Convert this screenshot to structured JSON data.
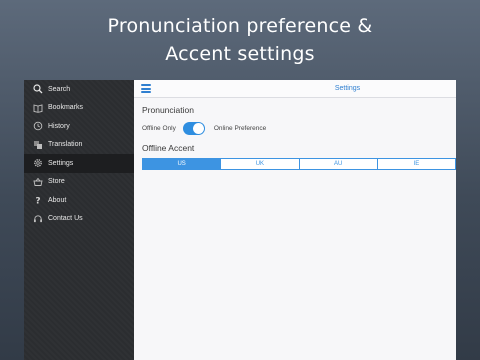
{
  "promo": {
    "line1": "Pronunciation preference &",
    "line2": "Accent settings"
  },
  "sidebar": {
    "items": [
      {
        "label": "Search",
        "icon": "search-icon"
      },
      {
        "label": "Bookmarks",
        "icon": "book-icon"
      },
      {
        "label": "History",
        "icon": "clock-icon"
      },
      {
        "label": "Translation",
        "icon": "translate-icon"
      },
      {
        "label": "Settings",
        "icon": "gear-icon",
        "active": true
      },
      {
        "label": "Store",
        "icon": "basket-icon"
      },
      {
        "label": "About",
        "icon": "question-icon"
      },
      {
        "label": "Contact Us",
        "icon": "headset-icon"
      }
    ]
  },
  "header": {
    "title": "Settings"
  },
  "pronunciation": {
    "title": "Pronunciation",
    "left_label": "Offline Only",
    "right_label": "Online Preference",
    "toggle_on": true
  },
  "accent": {
    "title": "Offline Accent",
    "options": [
      "US",
      "UK",
      "AU",
      "IE"
    ],
    "selected": "US"
  },
  "colors": {
    "accent": "#3d94e2",
    "sidebar_bg": "#2c2e31",
    "sidebar_active": "#1d1e20"
  }
}
